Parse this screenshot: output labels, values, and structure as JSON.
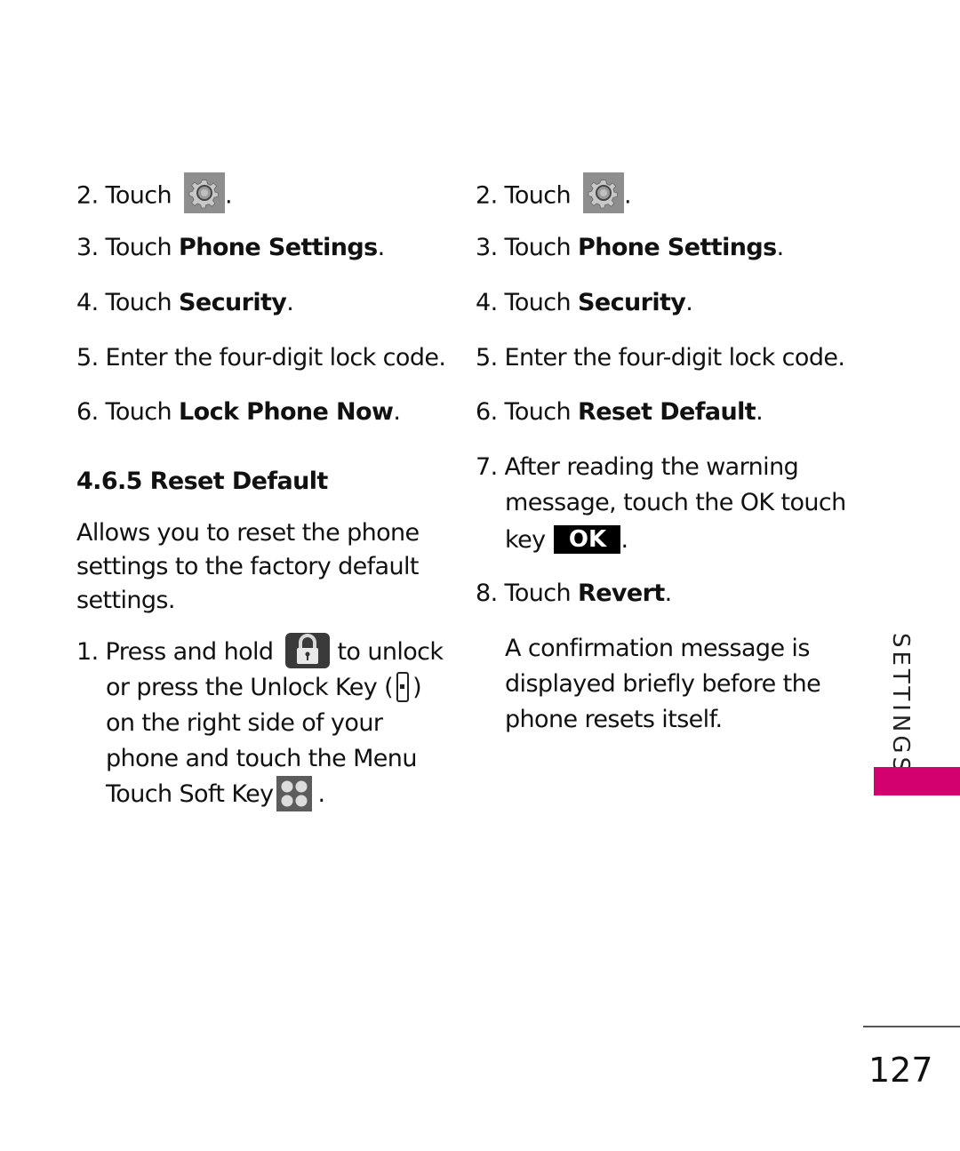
{
  "left_column": {
    "steps_top": [
      {
        "num": "2.",
        "text": "Touch",
        "icon": "settings-gear-icon",
        "suffix": "."
      },
      {
        "num": "3.",
        "text": "Touch ",
        "bold": "Phone Settings",
        "suffix": "."
      },
      {
        "num": "4.",
        "text": "Touch ",
        "bold": "Security",
        "suffix": "."
      },
      {
        "num": "5.",
        "text": "Enter the four-digit lock code."
      },
      {
        "num": "6.",
        "text": "Touch ",
        "bold": "Lock Phone Now",
        "suffix": "."
      }
    ],
    "section_heading": "4.6.5 Reset Default",
    "description_lines": [
      "Allows you to reset the phone",
      "settings to the factory default",
      "settings."
    ],
    "step1": {
      "num": "1.",
      "line1_a": "Press and hold",
      "line1_icon": "lock-icon",
      "line1_b": "to unlock",
      "line2_a": "or press the Unlock Key (",
      "line2_icon": "side-unlock-key-icon",
      "line2_b": ")",
      "line3": "on the right side of your",
      "line4": "phone and touch the Menu",
      "line5_a": "Touch Soft Key",
      "line5_icon": "menu-grid-icon",
      "line5_b": "."
    }
  },
  "right_column": {
    "steps": [
      {
        "num": "2.",
        "text": "Touch",
        "icon": "settings-gear-icon",
        "suffix": "."
      },
      {
        "num": "3.",
        "text": "Touch ",
        "bold": "Phone Settings",
        "suffix": "."
      },
      {
        "num": "4.",
        "text": "Touch ",
        "bold": "Security",
        "suffix": "."
      },
      {
        "num": "5.",
        "text": "Enter the four-digit lock code."
      },
      {
        "num": "6.",
        "text": "Touch ",
        "bold": "Reset Default",
        "suffix": "."
      }
    ],
    "step7": {
      "num": "7.",
      "line1": "After reading the warning",
      "line2": "message, touch the OK touch",
      "line3_a": "key",
      "ok_label": "OK",
      "line3_b": "."
    },
    "step8": {
      "num": "8.",
      "text": "Touch ",
      "bold": "Revert",
      "suffix": "."
    },
    "note_lines": [
      "A confirmation message is",
      "displayed briefly before the",
      "phone resets itself."
    ]
  },
  "side_tab": {
    "label": "SETTINGS",
    "accent_color": "#d3006f"
  },
  "page_number": "127"
}
